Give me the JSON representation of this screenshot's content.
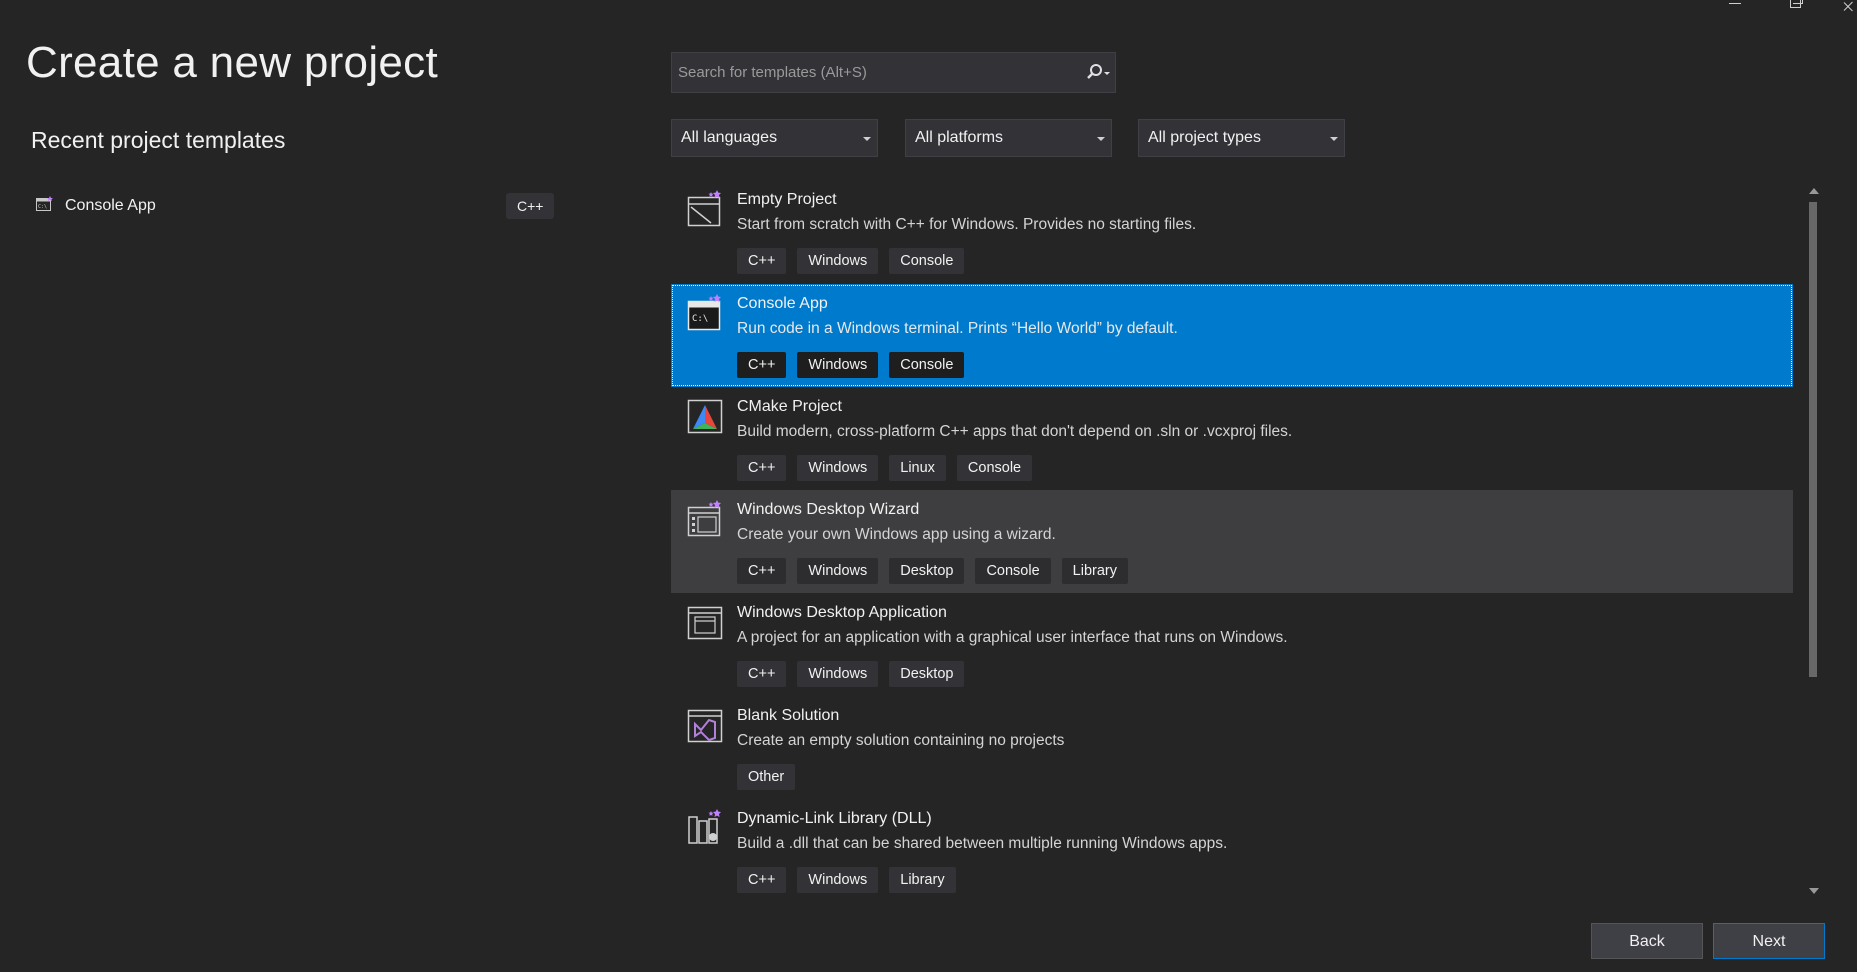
{
  "page": {
    "title": "Create a new project"
  },
  "recent": {
    "heading": "Recent project templates",
    "items": [
      {
        "label": "Console App",
        "badge": "C++",
        "icon": "console-app-icon"
      }
    ]
  },
  "search": {
    "placeholder": "Search for templates (Alt+S)",
    "value": ""
  },
  "filters": {
    "language": "All languages",
    "platform": "All platforms",
    "project_type": "All project types"
  },
  "templates": [
    {
      "name": "Empty Project",
      "description": "Start from scratch with C++ for Windows. Provides no starting files.",
      "tags": [
        "C++",
        "Windows",
        "Console"
      ],
      "icon": "empty-project-icon"
    },
    {
      "name": "Console App",
      "description": "Run code in a Windows terminal. Prints “Hello World” by default.",
      "tags": [
        "C++",
        "Windows",
        "Console"
      ],
      "icon": "console-app-icon",
      "selected": true
    },
    {
      "name": "CMake Project",
      "description": "Build modern, cross-platform C++ apps that don't depend on .sln or .vcxproj files.",
      "tags": [
        "C++",
        "Windows",
        "Linux",
        "Console"
      ],
      "icon": "cmake-icon"
    },
    {
      "name": "Windows Desktop Wizard",
      "description": "Create your own Windows app using a wizard.",
      "tags": [
        "C++",
        "Windows",
        "Desktop",
        "Console",
        "Library"
      ],
      "icon": "desktop-wizard-icon",
      "hovered": true
    },
    {
      "name": "Windows Desktop Application",
      "description": "A project for an application with a graphical user interface that runs on Windows.",
      "tags": [
        "C++",
        "Windows",
        "Desktop"
      ],
      "icon": "desktop-application-icon"
    },
    {
      "name": "Blank Solution",
      "description": "Create an empty solution containing no projects",
      "tags": [
        "Other"
      ],
      "icon": "blank-solution-icon"
    },
    {
      "name": "Dynamic-Link Library (DLL)",
      "description": "Build a .dll that can be shared between multiple running Windows apps.",
      "tags": [
        "C++",
        "Windows",
        "Library"
      ],
      "icon": "dll-icon"
    }
  ],
  "buttons": {
    "back": "Back",
    "next": "Next"
  },
  "colors": {
    "background": "#252526",
    "accent": "#007acc",
    "hover": "#3e3e40",
    "tag": "#333337"
  }
}
